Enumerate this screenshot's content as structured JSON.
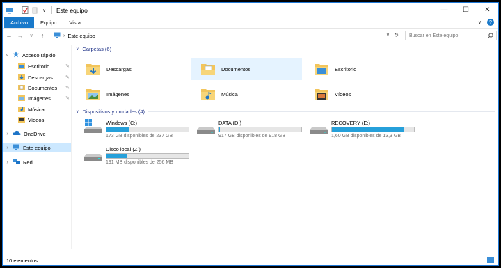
{
  "window": {
    "title": "Este equipo",
    "qat_dropdown": "∨",
    "controls": {
      "minimize": "—",
      "maximize": "☐",
      "close": "✕"
    }
  },
  "ribbon": {
    "tabs": [
      {
        "label": "Archivo",
        "active": true
      },
      {
        "label": "Equipo"
      },
      {
        "label": "Vista"
      }
    ],
    "collapse": "∨",
    "help": "?"
  },
  "navbar": {
    "back": "←",
    "forward": "→",
    "recent": "∨",
    "up": "↑",
    "location": "Este equipo",
    "search_placeholder": "Buscar en Este equipo"
  },
  "sidebar": {
    "quick_access": "Acceso rápido",
    "quick_items": [
      {
        "label": "Escritorio",
        "pinned": true
      },
      {
        "label": "Descargas",
        "pinned": true
      },
      {
        "label": "Documentos",
        "pinned": true
      },
      {
        "label": "Imágenes",
        "pinned": true
      },
      {
        "label": "Música"
      },
      {
        "label": "Vídeos"
      }
    ],
    "onedrive": "OneDrive",
    "this_pc": "Este equipo",
    "network": "Red"
  },
  "folders": {
    "header": "Carpetas (6)",
    "items": [
      {
        "label": "Descargas",
        "icon": "downloads-folder-icon"
      },
      {
        "label": "Documentos",
        "icon": "documents-folder-icon"
      },
      {
        "label": "Escritorio",
        "icon": "desktop-folder-icon"
      },
      {
        "label": "Imágenes",
        "icon": "pictures-folder-icon"
      },
      {
        "label": "Música",
        "icon": "music-folder-icon"
      },
      {
        "label": "Vídeos",
        "icon": "videos-folder-icon"
      }
    ]
  },
  "drives": {
    "header": "Dispositivos y unidades (4)",
    "items": [
      {
        "label": "Windows (C:)",
        "free": "173 GB disponibles de 237 GB",
        "used_fraction": 0.27,
        "icon": "windows-drive-icon"
      },
      {
        "label": "DATA (D:)",
        "free": "917 GB disponibles de 918 GB",
        "used_fraction": 0.001,
        "icon": "hard-drive-icon"
      },
      {
        "label": "RECOVERY (E:)",
        "free": "1,60 GB disponibles de 13,3 GB",
        "used_fraction": 0.88,
        "icon": "hard-drive-icon"
      },
      {
        "label": "Disco local (Z:)",
        "free": "191 MB disponibles de 256 MB",
        "used_fraction": 0.25,
        "icon": "hard-drive-icon"
      }
    ]
  },
  "status": {
    "count": "10 elementos"
  },
  "colors": {
    "accent": "#1979ca",
    "bar_fill": "#26a0da",
    "group_header": "#1e3287",
    "selected": "#cce8ff"
  }
}
